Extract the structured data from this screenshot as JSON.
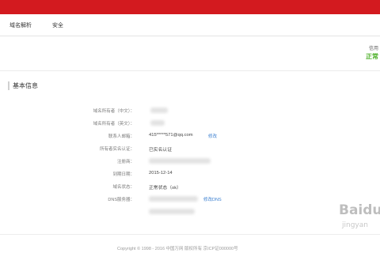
{
  "nav": {
    "items": [
      "域名解析",
      "安全"
    ]
  },
  "status": {
    "label": "信用",
    "value": "正常"
  },
  "section": {
    "title": "基本信息"
  },
  "info": {
    "rows": [
      {
        "label": "域名所有者（中文）：",
        "value": ""
      },
      {
        "label": "域名所有者（英文）：",
        "value": ""
      },
      {
        "label": "联系人邮箱：",
        "value": "415*****571@qq.com",
        "link": "修改"
      },
      {
        "label": "所有者实名认证：",
        "value": "已实名认证"
      },
      {
        "label": "注册商：",
        "value": ""
      },
      {
        "label": "到期日期：",
        "value": "2015-12-14"
      },
      {
        "label": "域名状态：",
        "value": "正常状态（ok）"
      },
      {
        "label": "DNS服务器：",
        "value": "",
        "link": "修改DNS"
      }
    ]
  },
  "footer": {
    "text": "Copyright © 1998 - 2016 中国万网 版权所有 京ICP证000000号"
  },
  "watermark": {
    "text": "Baidu",
    "sub": "jingyan"
  },
  "colors": {
    "brand": "#d31a1f",
    "status_ok": "#4caf28",
    "link": "#3a7fd0"
  }
}
